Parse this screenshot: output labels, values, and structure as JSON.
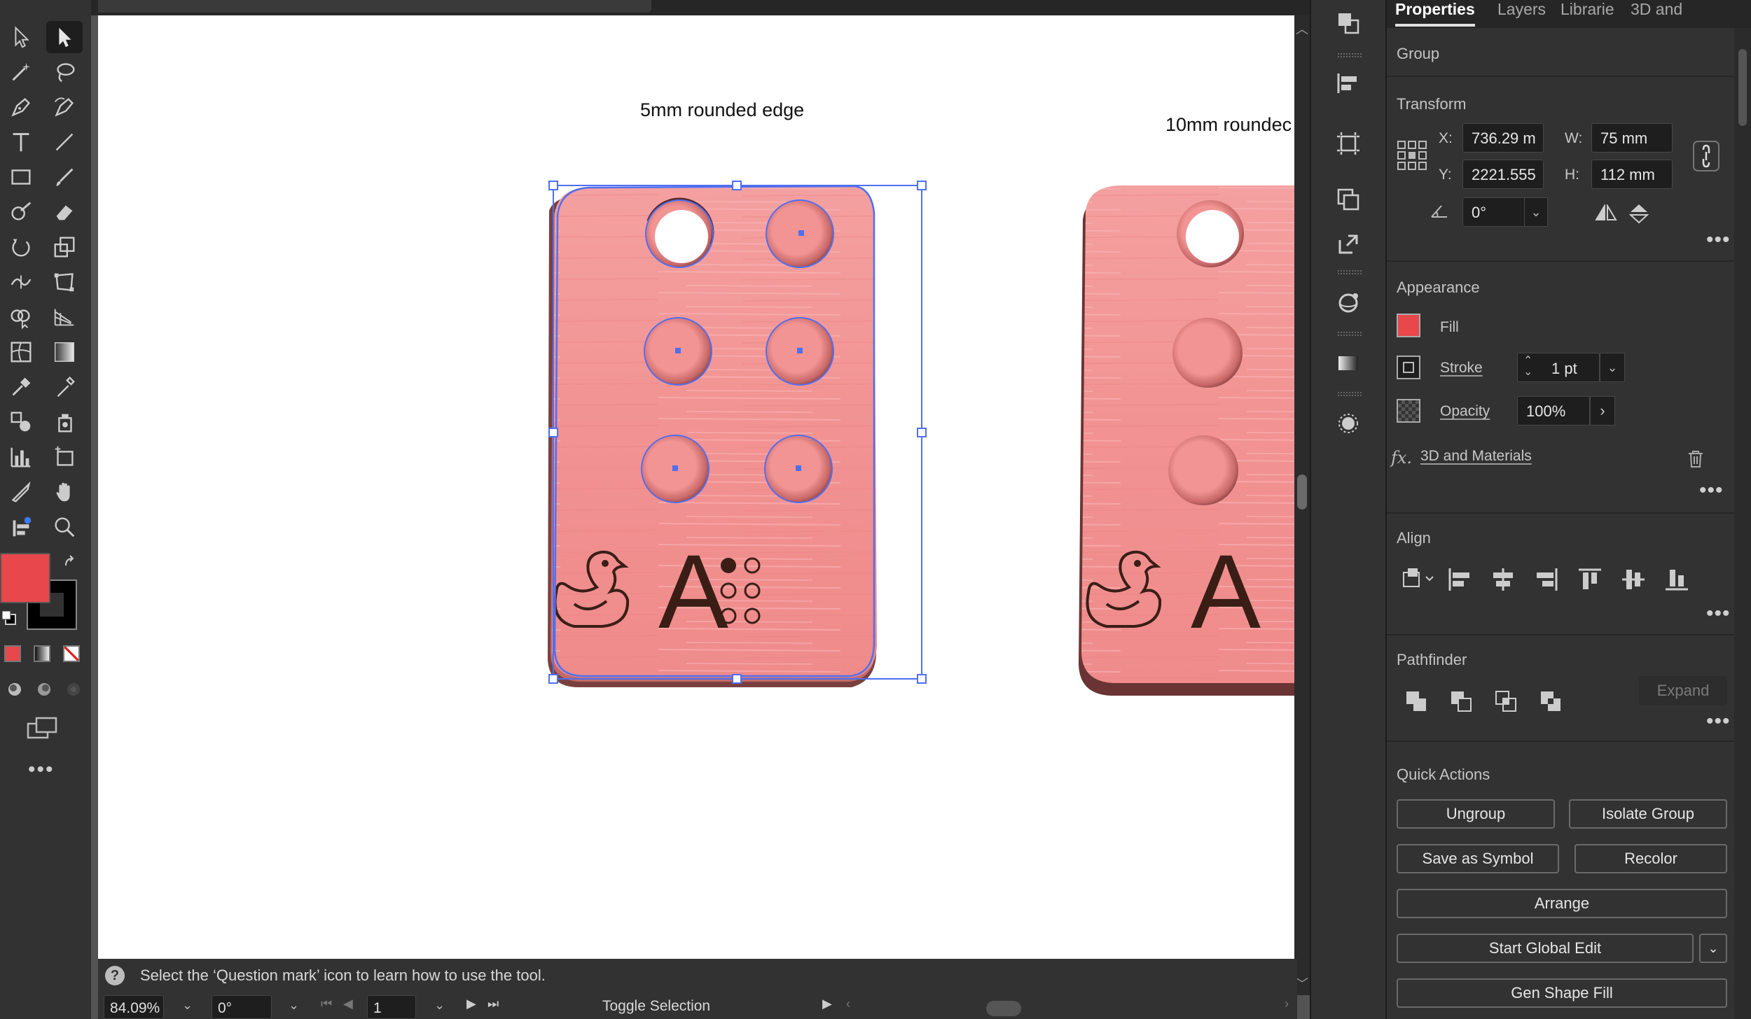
{
  "canvas": {
    "label_left": "5mm rounded edge",
    "label_right": "10mm roundec",
    "card_text": {
      "letter": "A"
    }
  },
  "statusbar": {
    "hint": "Select the ‘Question mark’ icon to learn how to use the tool.",
    "zoom": "84.09%",
    "rotation": "0°",
    "artboard_number": "1",
    "toggle_label": "Toggle Selection"
  },
  "panel": {
    "tabs": [
      "Properties",
      "Layers",
      "Librarie",
      "3D and"
    ],
    "selection_type": "Group",
    "transform": {
      "title": "Transform",
      "x_label": "X:",
      "x": "736.29 m",
      "y_label": "Y:",
      "y": "2221.555",
      "w_label": "W:",
      "w": "75 mm",
      "h_label": "H:",
      "h": "112 mm",
      "angle": "0°"
    },
    "appearance": {
      "title": "Appearance",
      "fill_label": "Fill",
      "fill_color": "#e8474c",
      "stroke_label": "Stroke",
      "stroke_value": "1 pt",
      "opacity_label": "Opacity",
      "opacity_value": "100%",
      "fx_label": "3D and Materials"
    },
    "align": {
      "title": "Align"
    },
    "pathfinder": {
      "title": "Pathfinder",
      "expand": "Expand"
    },
    "quick_actions": {
      "title": "Quick Actions",
      "ungroup": "Ungroup",
      "isolate": "Isolate Group",
      "save_symbol": "Save as Symbol",
      "recolor": "Recolor",
      "arrange": "Arrange",
      "global_edit": "Start Global Edit",
      "gen_shape": "Gen Shape Fill"
    }
  },
  "colors": {
    "accent_selection": "#4f6ff0",
    "card": "#f29797",
    "fill": "#e8474c"
  }
}
